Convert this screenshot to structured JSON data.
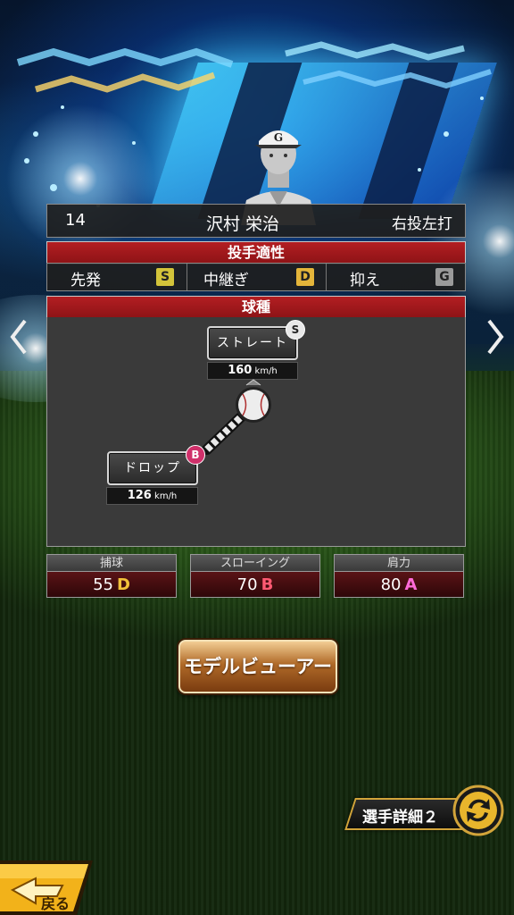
{
  "player": {
    "number": "14",
    "name": "沢村 栄治",
    "throw_bat": "右投左打",
    "cap_letter": "G"
  },
  "aptitude": {
    "title": "投手適性",
    "items": [
      {
        "label": "先発",
        "grade": "S",
        "color": "#d3c43a"
      },
      {
        "label": "中継ぎ",
        "grade": "D",
        "color": "#e4b53a"
      },
      {
        "label": "抑え",
        "grade": "G",
        "color": "#9a9a9a"
      }
    ]
  },
  "pitches": {
    "title": "球種",
    "straight": {
      "label": "ストレート",
      "grade": "S",
      "speed": "160",
      "unit": "km/h"
    },
    "breaking": [
      {
        "label": "ドロップ",
        "grade": "B",
        "speed": "126",
        "unit": "km/h"
      }
    ]
  },
  "stats": [
    {
      "label": "捕球",
      "value": "55",
      "grade": "D",
      "grade_color": "#f2c23a"
    },
    {
      "label": "スローイング",
      "value": "70",
      "grade": "B",
      "grade_color": "#ff5a72"
    },
    {
      "label": "肩力",
      "value": "80",
      "grade": "A",
      "grade_color": "#ff6ad8"
    }
  ],
  "buttons": {
    "model_viewer": "モデルビューアー",
    "player_detail2": "選手詳細２",
    "back": "戻る"
  },
  "colors": {
    "accent_gold": "#d2a43a",
    "title_red": "#b31e22",
    "grade_S_badge": "#e8e8e8",
    "grade_B_badge": "#d0306a"
  }
}
